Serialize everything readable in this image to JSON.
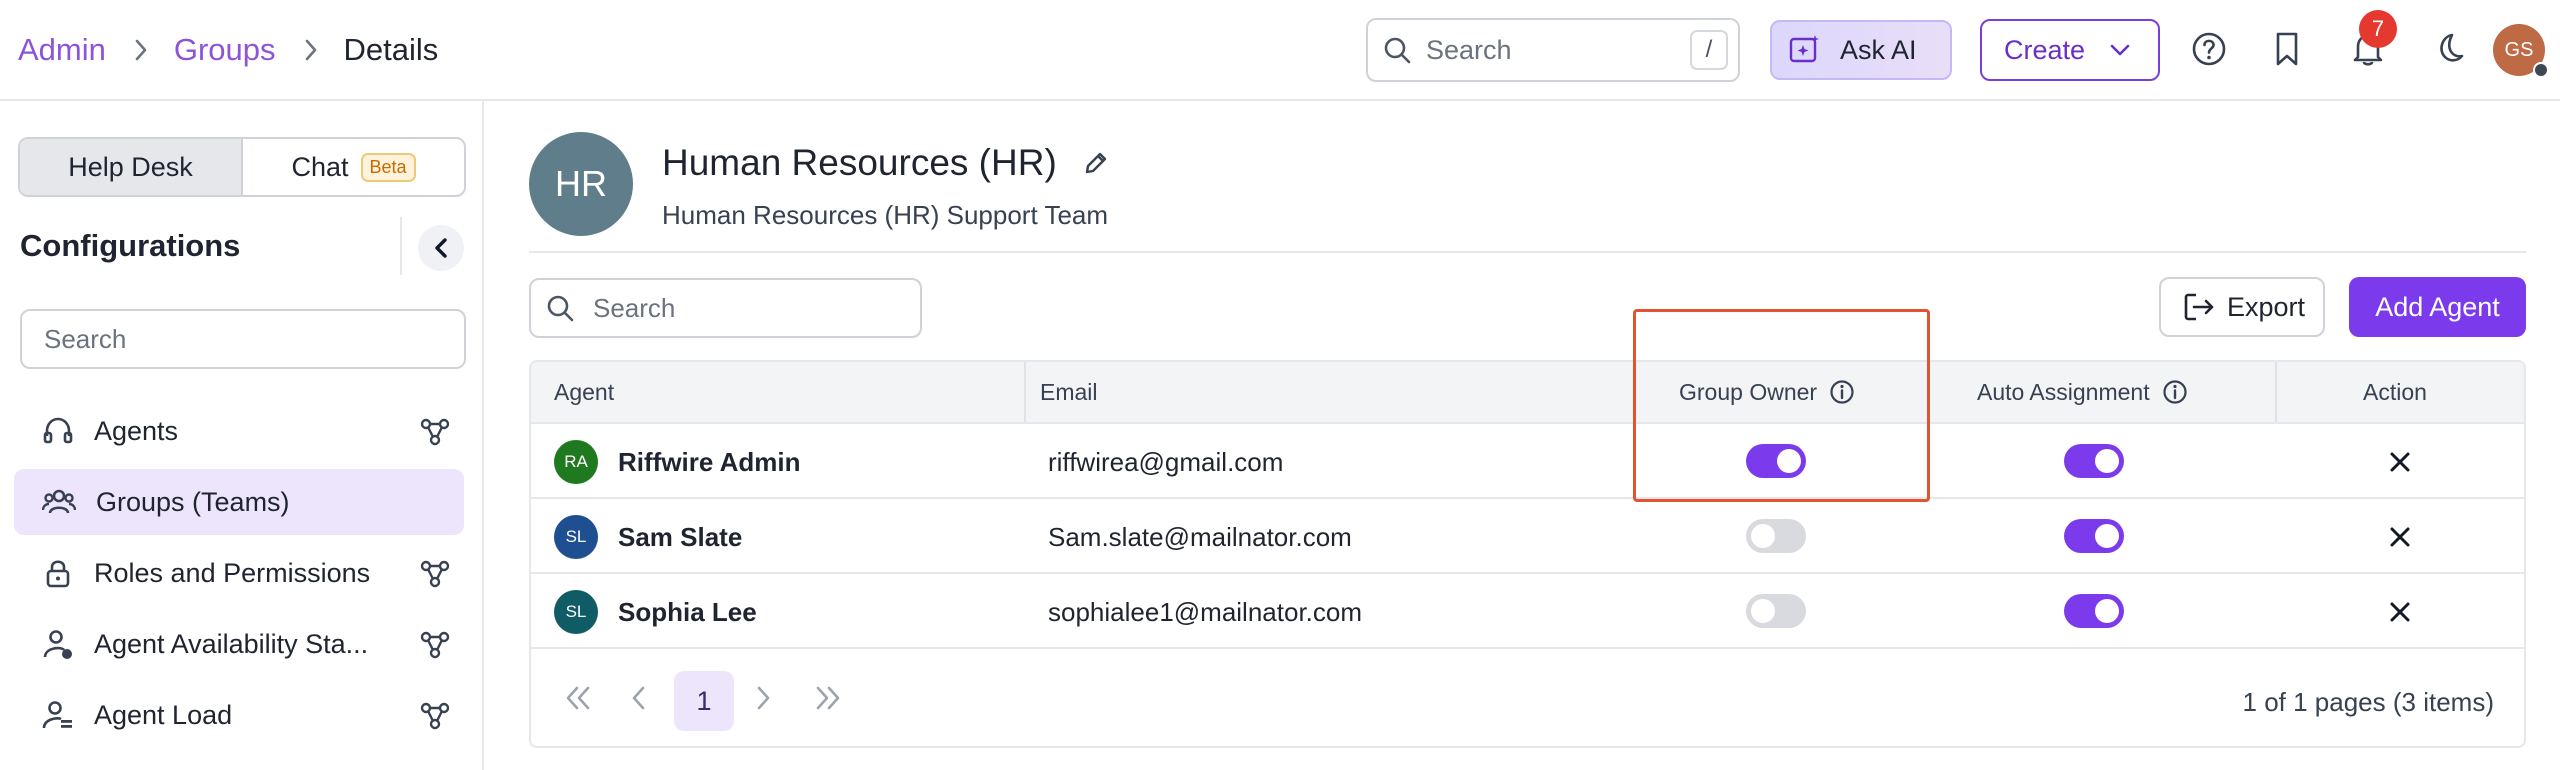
{
  "breadcrumb": [
    {
      "label": "Admin",
      "link": true
    },
    {
      "label": "Groups",
      "link": true
    },
    {
      "label": "Details",
      "link": false
    }
  ],
  "topbar": {
    "search_placeholder": "Search",
    "search_shortcut": "/",
    "ask_ai_label": "Ask AI",
    "create_label": "Create",
    "notification_count": "7",
    "user_initials": "GS"
  },
  "sidebar": {
    "tabs": [
      {
        "label": "Help Desk",
        "active": true
      },
      {
        "label": "Chat",
        "badge": "Beta",
        "active": false
      }
    ],
    "title": "Configurations",
    "search_placeholder": "Search",
    "items": [
      {
        "label": "Agents",
        "icon": "headset-icon",
        "active": false
      },
      {
        "label": "Groups (Teams)",
        "icon": "users-icon",
        "active": true
      },
      {
        "label": "Roles and Permissions",
        "icon": "lock-icon",
        "active": false
      },
      {
        "label": "Agent Availability Sta...",
        "icon": "user-status-icon",
        "active": false
      },
      {
        "label": "Agent Load",
        "icon": "user-load-icon",
        "active": false
      }
    ]
  },
  "group": {
    "initials": "HR",
    "name": "Human Resources (HR)",
    "description": "Human Resources (HR) Support Team"
  },
  "toolbar": {
    "search_placeholder": "Search",
    "export_label": "Export",
    "add_agent_label": "Add Agent"
  },
  "table": {
    "columns": [
      "Agent",
      "Email",
      "Group Owner",
      "Auto Assignment",
      "Action"
    ],
    "rows": [
      {
        "initials": "RA",
        "avatar_color": "#1f7a1f",
        "name": "Riffwire Admin",
        "email": "riffwirea@gmail.com",
        "group_owner": true,
        "auto_assignment": true
      },
      {
        "initials": "SL",
        "avatar_color": "#1d4f91",
        "name": "Sam Slate",
        "email": "Sam.slate@mailnator.com",
        "group_owner": false,
        "auto_assignment": true
      },
      {
        "initials": "SL",
        "avatar_color": "#0f5c66",
        "name": "Sophia Lee",
        "email": "sophialee1@mailnator.com",
        "group_owner": false,
        "auto_assignment": true
      }
    ]
  },
  "pagination": {
    "current_page": "1",
    "info": "1 of 1 pages (3 items)"
  },
  "colors": {
    "accent": "#7c3aed",
    "link": "#8d54d9",
    "highlight": "#e2542f"
  }
}
